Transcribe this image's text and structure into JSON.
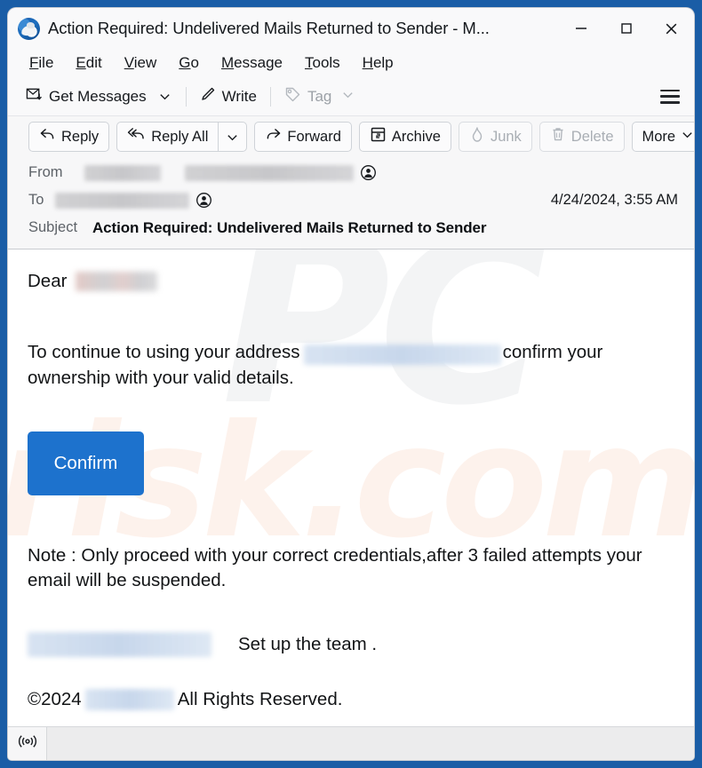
{
  "window": {
    "title": "Action Required: Undelivered Mails Returned to Sender - M...",
    "app_icon": "thunderbird-logo",
    "controls": {
      "minimize": "minimize-icon",
      "maximize": "maximize-icon",
      "close": "close-icon"
    },
    "frame_color": "#1a5da6"
  },
  "menubar": {
    "items": [
      {
        "label": "File",
        "accesskey": "F"
      },
      {
        "label": "Edit",
        "accesskey": "E"
      },
      {
        "label": "View",
        "accesskey": "V"
      },
      {
        "label": "Go",
        "accesskey": "G"
      },
      {
        "label": "Message",
        "accesskey": "M"
      },
      {
        "label": "Tools",
        "accesskey": "T"
      },
      {
        "label": "Help",
        "accesskey": "H"
      }
    ]
  },
  "toolbar": {
    "get_messages": "Get Messages",
    "write": "Write",
    "tag": "Tag",
    "tag_disabled": true,
    "app_menu": "hamburger-icon"
  },
  "message_toolbar": {
    "reply": "Reply",
    "reply_all": "Reply All",
    "forward": "Forward",
    "archive": "Archive",
    "junk": "Junk",
    "junk_disabled": true,
    "delete": "Delete",
    "delete_disabled": true,
    "more": "More"
  },
  "headers": {
    "from_label": "From",
    "from_name_redacted": true,
    "from_address_redacted": true,
    "to_label": "To",
    "to_address_redacted": true,
    "date": "4/24/2024, 3:55 AM",
    "subject_label": "Subject",
    "subject": "Action Required: Undelivered Mails Returned to Sender"
  },
  "body": {
    "greeting": "Dear",
    "greeting_name_redacted": true,
    "paragraph_before_address": "To continue to using your address",
    "paragraph_after_address": "confirm your ownership with your valid details.",
    "address_redacted": true,
    "confirm_button": "Confirm",
    "note": "Note : Only proceed with your correct credentials,after 3 failed attempts your email will be suspended.",
    "signature_redacted": true,
    "signature_text": "Set up the team .",
    "copyright_prefix": "©2024",
    "copyright_company_redacted": true,
    "copyright_suffix": "All Rights Reserved.",
    "watermark_primary": "PC",
    "watermark_secondary": "risk.com",
    "confirm_button_color": "#1d72cd"
  },
  "statusbar": {
    "connection_icon": "online-indicator-icon"
  }
}
